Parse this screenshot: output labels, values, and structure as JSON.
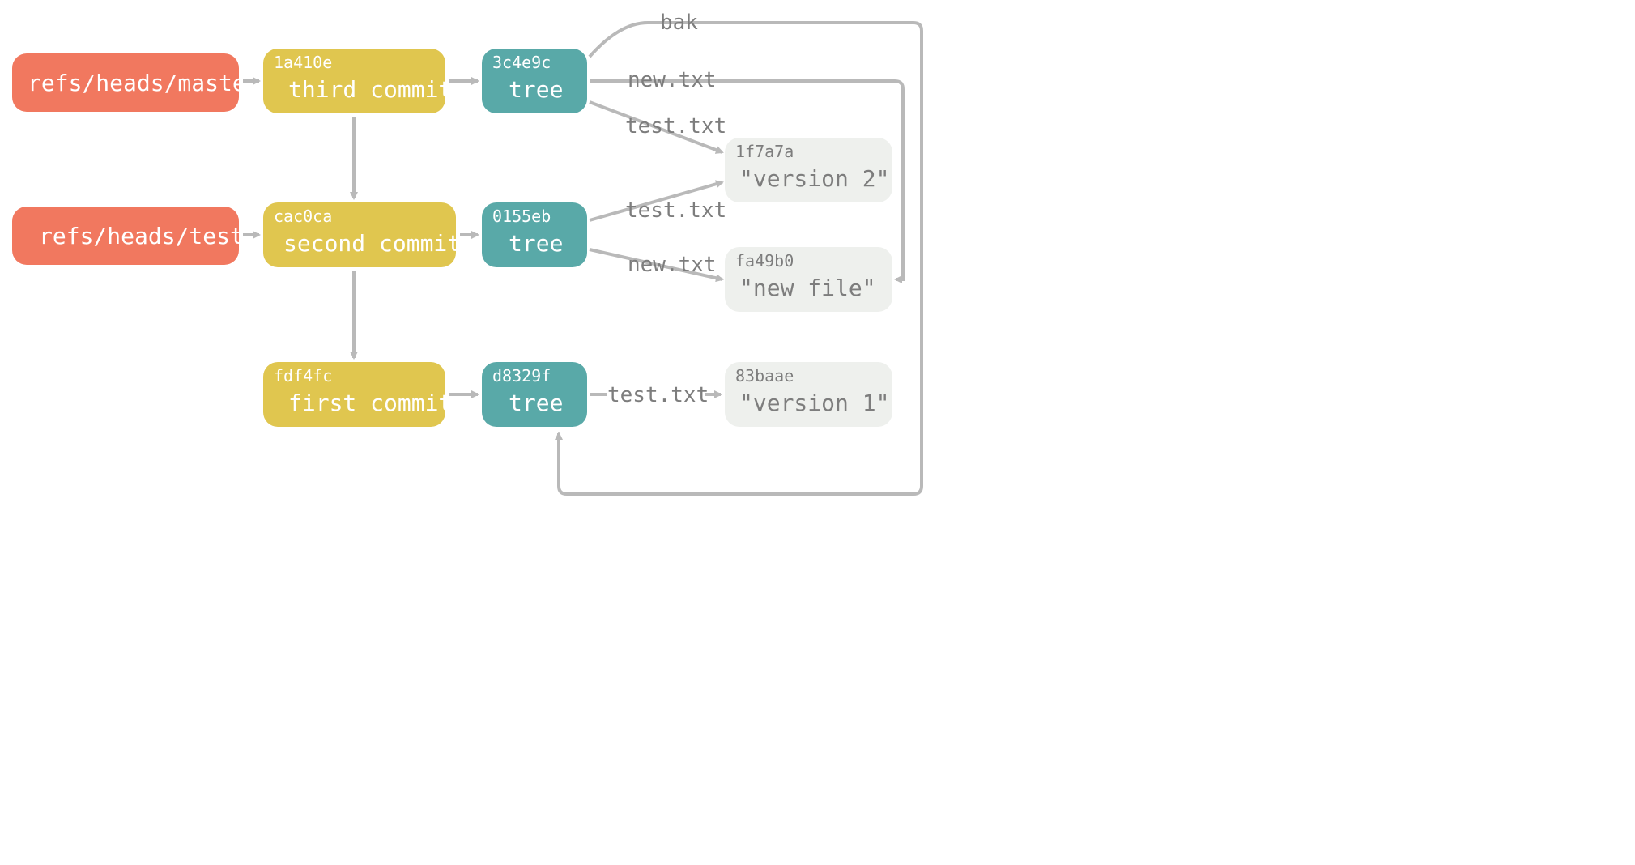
{
  "refs": {
    "master": "refs/heads/master",
    "test": "refs/heads/test"
  },
  "commits": {
    "third": {
      "sha": "1a410e",
      "label": "third commit"
    },
    "second": {
      "sha": "cac0ca",
      "label": "second commit"
    },
    "first": {
      "sha": "fdf4fc",
      "label": "first commit"
    }
  },
  "trees": {
    "t3": {
      "sha": "3c4e9c",
      "label": "tree"
    },
    "t2": {
      "sha": "0155eb",
      "label": "tree"
    },
    "t1": {
      "sha": "d8329f",
      "label": "tree"
    }
  },
  "blobs": {
    "v2": {
      "sha": "1f7a7a",
      "label": "\"version 2\""
    },
    "nf": {
      "sha": "fa49b0",
      "label": "\"new file\""
    },
    "v1": {
      "sha": "83baae",
      "label": "\"version 1\""
    }
  },
  "edges": {
    "bak": "bak",
    "new1": "new.txt",
    "test1": "test.txt",
    "test2": "test.txt",
    "new2": "new.txt",
    "test3": "test.txt"
  }
}
